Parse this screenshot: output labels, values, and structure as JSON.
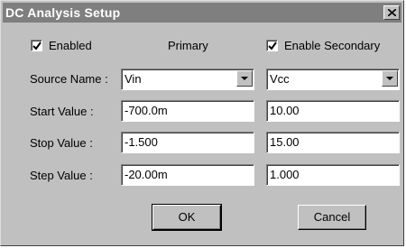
{
  "window": {
    "title": "DC Analysis Setup"
  },
  "options": {
    "enabled_label": "Enabled",
    "enabled_checked": true,
    "primary_label": "Primary",
    "secondary_label": "Enable Secondary",
    "secondary_checked": true
  },
  "rows": {
    "source_name_label": "Source Name :",
    "start_label": "Start Value :",
    "stop_label": "Stop Value :",
    "step_label": "Step Value :"
  },
  "primary": {
    "source": "Vin",
    "start": "-700.0m",
    "stop": "-1.500",
    "step": "-20.00m"
  },
  "secondary": {
    "source": "Vcc",
    "start": "10.00",
    "stop": "15.00",
    "step": "1.000"
  },
  "buttons": {
    "ok_label": "OK",
    "cancel_label": "Cancel"
  }
}
